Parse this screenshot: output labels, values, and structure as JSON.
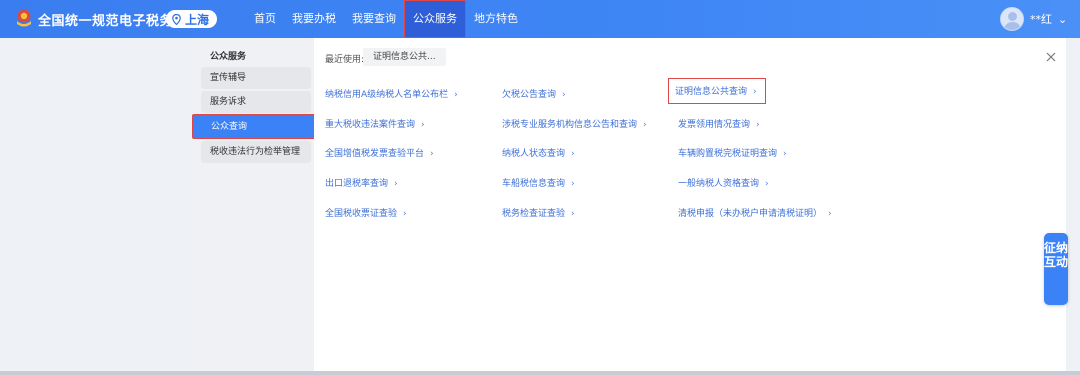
{
  "header": {
    "title": "全国统一规范电子税务局",
    "region": "上海",
    "nav": [
      "首页",
      "我要办税",
      "我要查询",
      "公众服务",
      "地方特色"
    ],
    "active_nav": "公众服务",
    "user_name": "**红",
    "user_caret": "⌄"
  },
  "sidebar": {
    "heading": "公众服务",
    "items": [
      "宣传辅导",
      "服务诉求",
      "公众查询",
      "税收违法行为检举管理"
    ],
    "active": "公众查询"
  },
  "panel": {
    "recent_label": "最近使用:",
    "recent_chip": "证明信息公共...",
    "chevron": "›",
    "links": [
      [
        "纳税信用A级纳税人名单公布栏",
        "欠税公告查询",
        "证明信息公共查询"
      ],
      [
        "重大税收违法案件查询",
        "涉税专业服务机构信息公告和查询",
        "发票领用情况查询"
      ],
      [
        "全国增值税发票查验平台",
        "纳税人状态查询",
        "车辆购置税完税证明查询"
      ],
      [
        "出口退税率查询",
        "车船税信息查询",
        "一般纳税人资格查询"
      ],
      [
        "全国税收票证查验",
        "税务检查证查验",
        "清税申报（未办税户申请清税证明）"
      ]
    ],
    "highlighted_link": "证明信息公共查询"
  },
  "float_widget": {
    "label": "征纳互动"
  },
  "colors": {
    "header_blue": "#3f86f5",
    "accent_blue": "#3b82f6",
    "link_blue": "#3d6fd6",
    "highlight_red": "#e04848"
  }
}
